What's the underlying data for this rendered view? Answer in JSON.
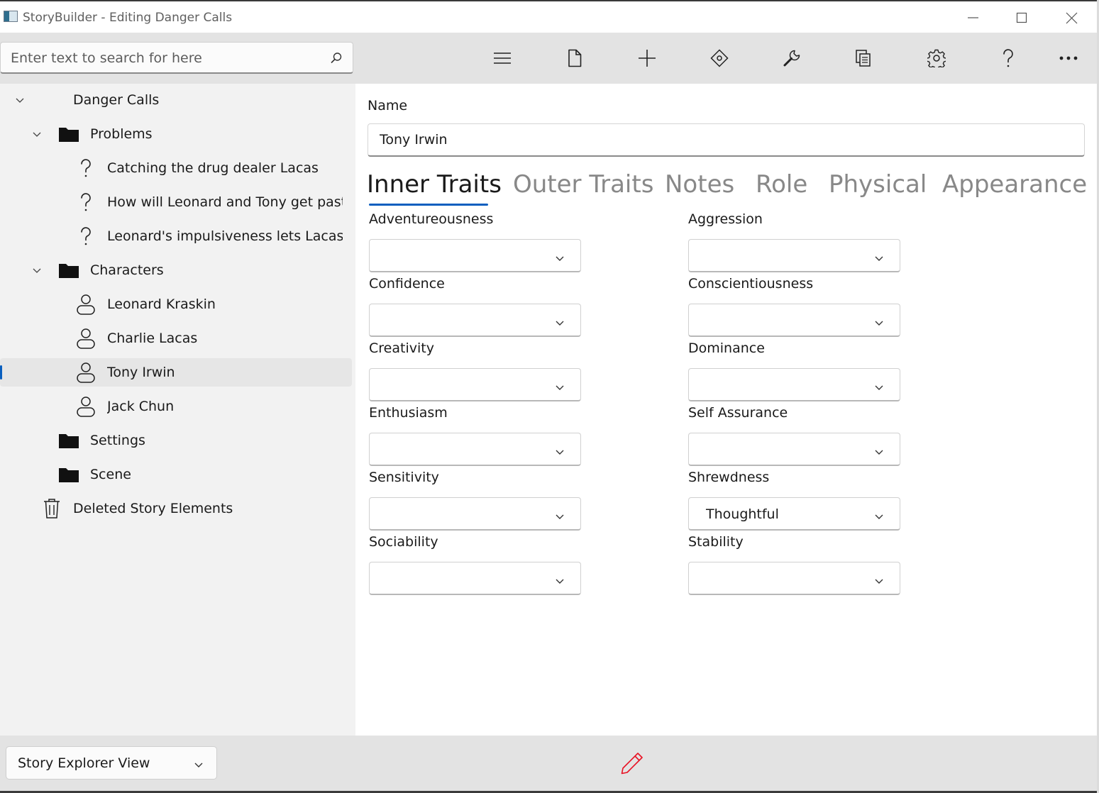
{
  "window": {
    "title": "StoryBuilder - Editing Danger Calls"
  },
  "toolbar": {
    "search_placeholder": "Enter text to search for here",
    "buttons": [
      "menu-icon",
      "new-file-icon",
      "add-icon",
      "move-icon",
      "wrench-icon",
      "copy-icon",
      "gear-icon",
      "help-icon",
      "more-icon"
    ]
  },
  "tree": {
    "root": "Danger Calls",
    "problems_folder": "Problems",
    "problems": [
      "Catching the drug dealer Lacas",
      "How will Leonard and Tony get past",
      "Leonard's impulsiveness lets Lacas c"
    ],
    "characters_folder": "Characters",
    "characters": [
      "Leonard Kraskin",
      "Charlie Lacas",
      "Tony Irwin",
      "Jack Chun"
    ],
    "selected": "Tony Irwin",
    "settings_folder": "Settings",
    "scene_folder": "Scene",
    "trash": "Deleted Story Elements"
  },
  "form": {
    "name_label": "Name",
    "name_value": "Tony Irwin",
    "tabs": [
      "Inner Traits",
      "Outer Traits",
      "Notes",
      "Role",
      "Physical",
      "Appearance"
    ],
    "active_tab": "Inner Traits",
    "fields_left": [
      {
        "label": "Adventureousness",
        "value": ""
      },
      {
        "label": "Confidence",
        "value": ""
      },
      {
        "label": "Creativity",
        "value": ""
      },
      {
        "label": "Enthusiasm",
        "value": ""
      },
      {
        "label": "Sensitivity",
        "value": ""
      },
      {
        "label": "Sociability",
        "value": ""
      }
    ],
    "fields_right": [
      {
        "label": "Aggression",
        "value": ""
      },
      {
        "label": "Conscientiousness",
        "value": ""
      },
      {
        "label": "Dominance",
        "value": ""
      },
      {
        "label": "Self Assurance",
        "value": ""
      },
      {
        "label": "Shrewdness",
        "value": "Thoughtful"
      },
      {
        "label": "Stability",
        "value": ""
      }
    ]
  },
  "bottom": {
    "view_selector": "Story Explorer View",
    "edit_icon_color": "#e81123"
  },
  "colors": {
    "accent": "#0a5fbf",
    "chrome": "#e3e3e3",
    "sidebar": "#f2f2f2"
  }
}
